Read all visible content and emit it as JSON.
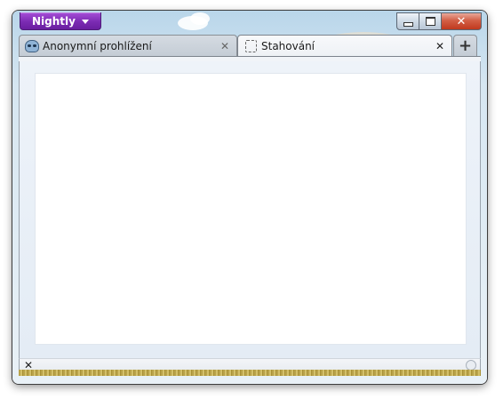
{
  "app": {
    "menu_button_label": "Nightly"
  },
  "window_controls": {
    "minimize": "minimize",
    "maximize": "maximize",
    "close": "✕"
  },
  "tabs": [
    {
      "label": "Anonymní prohlížení",
      "icon": "private-browsing-mask-icon",
      "active": false,
      "close": "✕"
    },
    {
      "label": "Stahování",
      "icon": "downloads-dashed-icon",
      "active": true,
      "close": "✕"
    }
  ],
  "new_tab_label": "+",
  "status_bar": {
    "close_label": "✕",
    "clear_icon": "clear-list-icon"
  },
  "colors": {
    "nightly_purple": "#7b2bb3",
    "close_red": "#c0391e",
    "sky_blue": "#b9d6ea"
  }
}
